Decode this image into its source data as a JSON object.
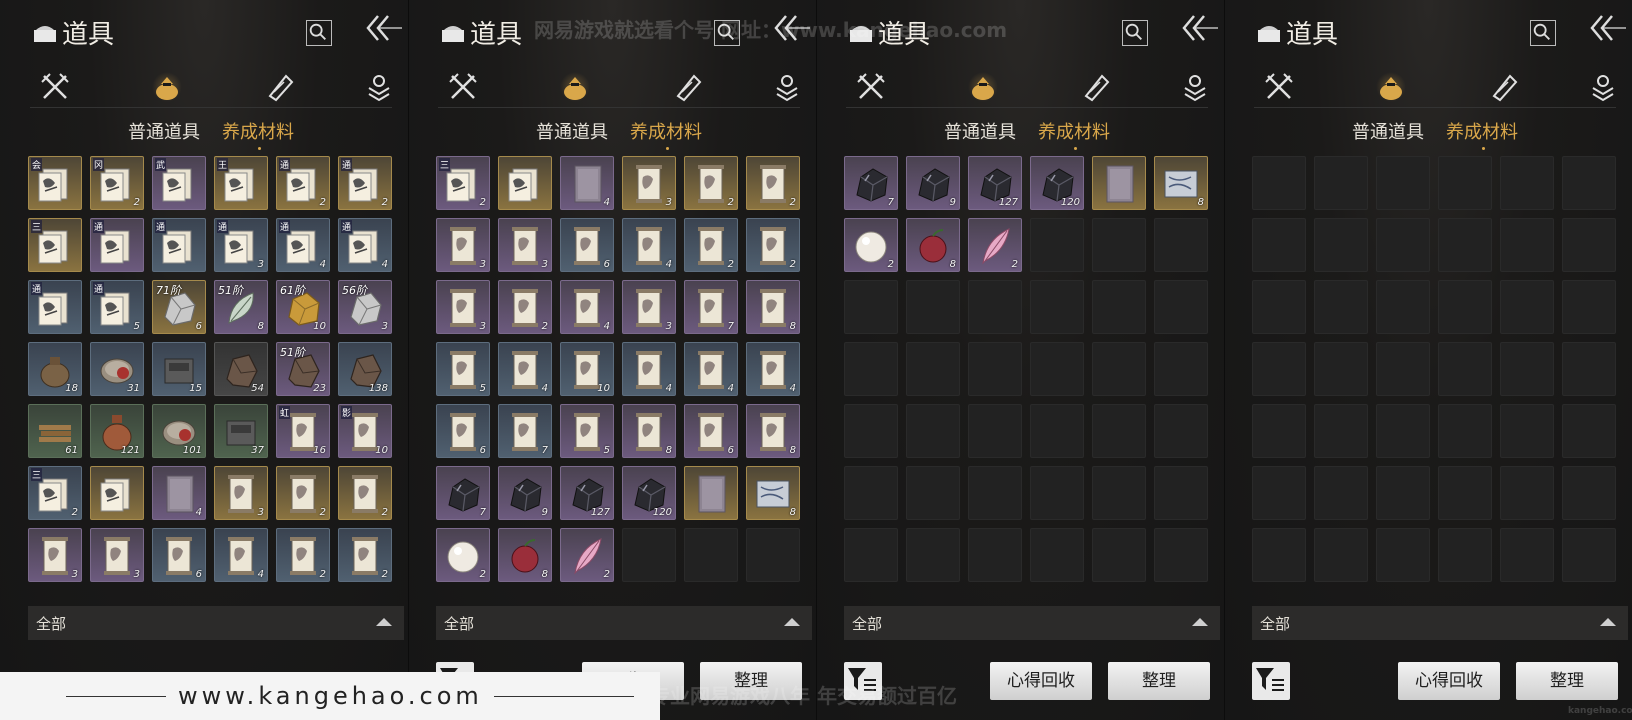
{
  "watermark": {
    "footer_url": "www.kangehao.com",
    "top_text": "网易游戏就选看个号   网址：www.kangehao.com",
    "bottom_text": "看个号专业网易游戏八年 年交易额过百亿",
    "corner_text": "kangehao.com"
  },
  "panels": [
    {
      "title": "道具",
      "sub_tabs": [
        "普通道具",
        "养成材料"
      ],
      "active_sub_tab": 1,
      "filter_label": "全部",
      "show_buttons": false,
      "buttons": {
        "recycle": "",
        "sort": ""
      },
      "slots": [
        {
          "q": "gold",
          "a": "book",
          "tag": "会",
          "c": ""
        },
        {
          "q": "gold",
          "a": "book",
          "tag": "冈",
          "c": "2"
        },
        {
          "q": "purple",
          "a": "book",
          "tag": "武",
          "c": ""
        },
        {
          "q": "gold",
          "a": "book",
          "tag": "王",
          "c": ""
        },
        {
          "q": "gold",
          "a": "book",
          "tag": "通",
          "c": "2"
        },
        {
          "q": "gold",
          "a": "book",
          "tag": "通",
          "c": "2"
        },
        {
          "q": "gold",
          "a": "book",
          "tag": "三",
          "c": ""
        },
        {
          "q": "purple",
          "a": "book",
          "tag": "通",
          "c": ""
        },
        {
          "q": "blue",
          "a": "book",
          "tag": "通",
          "c": ""
        },
        {
          "q": "blue",
          "a": "book",
          "tag": "通",
          "c": "3"
        },
        {
          "q": "blue",
          "a": "book",
          "tag": "通",
          "c": "4"
        },
        {
          "q": "blue",
          "a": "book",
          "tag": "通",
          "c": "4"
        },
        {
          "q": "blue",
          "a": "book",
          "tag": "通",
          "c": ""
        },
        {
          "q": "blue",
          "a": "book",
          "tag": "通",
          "c": "5"
        },
        {
          "q": "gold",
          "a": "ore",
          "tier": "71阶",
          "c": "6"
        },
        {
          "q": "purple",
          "a": "leaf",
          "tier": "51阶",
          "c": "8"
        },
        {
          "q": "purple",
          "a": "gold",
          "tier": "61阶",
          "c": "10"
        },
        {
          "q": "purple",
          "a": "ore",
          "tier": "56阶",
          "c": "3"
        },
        {
          "q": "blue",
          "a": "pouch",
          "c": "18"
        },
        {
          "q": "blue",
          "a": "disc",
          "c": "31"
        },
        {
          "q": "blue",
          "a": "box",
          "c": "15"
        },
        {
          "q": "grey",
          "a": "rock",
          "c": "54"
        },
        {
          "q": "purple",
          "a": "rock",
          "tier": "51阶",
          "c": "23"
        },
        {
          "q": "blue",
          "a": "rock",
          "c": "138"
        },
        {
          "q": "green",
          "a": "wood",
          "c": "61"
        },
        {
          "q": "green",
          "a": "jar",
          "c": "121"
        },
        {
          "q": "green",
          "a": "disc",
          "c": "101"
        },
        {
          "q": "green",
          "a": "box",
          "c": "37"
        },
        {
          "q": "purple",
          "a": "scroll",
          "tag": "虹",
          "c": "16"
        },
        {
          "q": "purple",
          "a": "scroll",
          "tag": "影",
          "c": "10"
        },
        {
          "q": "blue",
          "a": "book",
          "tag": "三",
          "c": "2"
        },
        {
          "q": "gold",
          "a": "book",
          "c": ""
        },
        {
          "q": "purple",
          "a": "plain",
          "c": "4"
        },
        {
          "q": "gold",
          "a": "scroll",
          "c": "3"
        },
        {
          "q": "gold",
          "a": "scroll",
          "c": "2"
        },
        {
          "q": "gold",
          "a": "scroll",
          "c": "2"
        },
        {
          "q": "purple",
          "a": "scroll",
          "c": "3"
        },
        {
          "q": "purple",
          "a": "scroll",
          "c": "3"
        },
        {
          "q": "blue",
          "a": "scroll",
          "c": "6"
        },
        {
          "q": "blue",
          "a": "scroll",
          "c": "4"
        },
        {
          "q": "blue",
          "a": "scroll",
          "c": "2"
        },
        {
          "q": "blue",
          "a": "scroll",
          "c": "2"
        }
      ]
    },
    {
      "title": "道具",
      "sub_tabs": [
        "普通道具",
        "养成材料"
      ],
      "active_sub_tab": 1,
      "filter_label": "全部",
      "show_buttons": true,
      "buttons": {
        "recycle": "收",
        "sort": "整理"
      },
      "slots": [
        {
          "q": "purple",
          "a": "book",
          "tag": "三",
          "c": "2"
        },
        {
          "q": "gold",
          "a": "book",
          "c": ""
        },
        {
          "q": "purple",
          "a": "plain",
          "c": "4"
        },
        {
          "q": "gold",
          "a": "scroll",
          "c": "3"
        },
        {
          "q": "gold",
          "a": "scroll",
          "c": "2"
        },
        {
          "q": "gold",
          "a": "scroll",
          "c": "2"
        },
        {
          "q": "purple",
          "a": "scroll",
          "c": "3"
        },
        {
          "q": "purple",
          "a": "scroll",
          "c": "3"
        },
        {
          "q": "blue",
          "a": "scroll",
          "c": "6"
        },
        {
          "q": "blue",
          "a": "scroll",
          "c": "4"
        },
        {
          "q": "blue",
          "a": "scroll",
          "c": "2"
        },
        {
          "q": "blue",
          "a": "scroll",
          "c": "2"
        },
        {
          "q": "purple",
          "a": "scroll",
          "c": "3"
        },
        {
          "q": "purple",
          "a": "scroll",
          "c": "2"
        },
        {
          "q": "purple",
          "a": "scroll",
          "c": "4"
        },
        {
          "q": "purple",
          "a": "scroll",
          "c": "3"
        },
        {
          "q": "purple",
          "a": "scroll",
          "c": "7"
        },
        {
          "q": "purple",
          "a": "scroll",
          "c": "8"
        },
        {
          "q": "blue",
          "a": "scroll",
          "c": "5"
        },
        {
          "q": "blue",
          "a": "scroll",
          "c": "4"
        },
        {
          "q": "blue",
          "a": "scroll",
          "c": "10"
        },
        {
          "q": "blue",
          "a": "scroll",
          "c": "4"
        },
        {
          "q": "blue",
          "a": "scroll",
          "c": "4"
        },
        {
          "q": "blue",
          "a": "scroll",
          "c": "4"
        },
        {
          "q": "blue",
          "a": "scroll",
          "c": "6"
        },
        {
          "q": "blue",
          "a": "scroll",
          "c": "7"
        },
        {
          "q": "purple",
          "a": "scroll",
          "c": "5"
        },
        {
          "q": "purple",
          "a": "scroll",
          "c": "8"
        },
        {
          "q": "purple",
          "a": "scroll",
          "c": "6"
        },
        {
          "q": "purple",
          "a": "scroll",
          "c": "8"
        },
        {
          "q": "purple",
          "a": "coal",
          "c": "7"
        },
        {
          "q": "purple",
          "a": "coal",
          "c": "9"
        },
        {
          "q": "purple",
          "a": "coal",
          "c": "127"
        },
        {
          "q": "purple",
          "a": "coal",
          "c": "120"
        },
        {
          "q": "gold",
          "a": "plain",
          "c": ""
        },
        {
          "q": "gold",
          "a": "map",
          "c": "8"
        },
        {
          "q": "purple",
          "a": "pearl",
          "c": "2"
        },
        {
          "q": "purple",
          "a": "fruit",
          "c": "8"
        },
        {
          "q": "purple",
          "a": "feather",
          "c": "2"
        },
        {
          "q": "empty"
        },
        {
          "q": "empty"
        },
        {
          "q": "empty"
        }
      ]
    },
    {
      "title": "道具",
      "sub_tabs": [
        "普通道具",
        "养成材料"
      ],
      "active_sub_tab": 1,
      "filter_label": "全部",
      "show_buttons": true,
      "buttons": {
        "recycle": "心得回收",
        "sort": "整理"
      },
      "slots": [
        {
          "q": "purple",
          "a": "coal",
          "c": "7"
        },
        {
          "q": "purple",
          "a": "coal",
          "c": "9"
        },
        {
          "q": "purple",
          "a": "coal",
          "c": "127"
        },
        {
          "q": "purple",
          "a": "coal",
          "c": "120"
        },
        {
          "q": "gold",
          "a": "plain",
          "c": ""
        },
        {
          "q": "gold",
          "a": "map",
          "c": "8"
        },
        {
          "q": "purple",
          "a": "pearl",
          "c": "2"
        },
        {
          "q": "purple",
          "a": "fruit",
          "c": "8"
        },
        {
          "q": "purple",
          "a": "feather",
          "c": "2"
        },
        {
          "q": "empty"
        },
        {
          "q": "empty"
        },
        {
          "q": "empty"
        },
        {
          "q": "empty"
        },
        {
          "q": "empty"
        },
        {
          "q": "empty"
        },
        {
          "q": "empty"
        },
        {
          "q": "empty"
        },
        {
          "q": "empty"
        },
        {
          "q": "empty"
        },
        {
          "q": "empty"
        },
        {
          "q": "empty"
        },
        {
          "q": "empty"
        },
        {
          "q": "empty"
        },
        {
          "q": "empty"
        },
        {
          "q": "empty"
        },
        {
          "q": "empty"
        },
        {
          "q": "empty"
        },
        {
          "q": "empty"
        },
        {
          "q": "empty"
        },
        {
          "q": "empty"
        },
        {
          "q": "empty"
        },
        {
          "q": "empty"
        },
        {
          "q": "empty"
        },
        {
          "q": "empty"
        },
        {
          "q": "empty"
        },
        {
          "q": "empty"
        },
        {
          "q": "empty"
        },
        {
          "q": "empty"
        },
        {
          "q": "empty"
        },
        {
          "q": "empty"
        },
        {
          "q": "empty"
        },
        {
          "q": "empty"
        }
      ]
    },
    {
      "title": "道具",
      "sub_tabs": [
        "普通道具",
        "养成材料"
      ],
      "active_sub_tab": 1,
      "filter_label": "全部",
      "show_buttons": true,
      "buttons": {
        "recycle": "心得回收",
        "sort": "整理"
      },
      "slots": [
        {
          "q": "empty"
        },
        {
          "q": "empty"
        },
        {
          "q": "empty"
        },
        {
          "q": "empty"
        },
        {
          "q": "empty"
        },
        {
          "q": "empty"
        },
        {
          "q": "empty"
        },
        {
          "q": "empty"
        },
        {
          "q": "empty"
        },
        {
          "q": "empty"
        },
        {
          "q": "empty"
        },
        {
          "q": "empty"
        },
        {
          "q": "empty"
        },
        {
          "q": "empty"
        },
        {
          "q": "empty"
        },
        {
          "q": "empty"
        },
        {
          "q": "empty"
        },
        {
          "q": "empty"
        },
        {
          "q": "empty"
        },
        {
          "q": "empty"
        },
        {
          "q": "empty"
        },
        {
          "q": "empty"
        },
        {
          "q": "empty"
        },
        {
          "q": "empty"
        },
        {
          "q": "empty"
        },
        {
          "q": "empty"
        },
        {
          "q": "empty"
        },
        {
          "q": "empty"
        },
        {
          "q": "empty"
        },
        {
          "q": "empty"
        },
        {
          "q": "empty"
        },
        {
          "q": "empty"
        },
        {
          "q": "empty"
        },
        {
          "q": "empty"
        },
        {
          "q": "empty"
        },
        {
          "q": "empty"
        },
        {
          "q": "empty"
        },
        {
          "q": "empty"
        },
        {
          "q": "empty"
        },
        {
          "q": "empty"
        },
        {
          "q": "empty"
        },
        {
          "q": "empty"
        }
      ]
    }
  ]
}
